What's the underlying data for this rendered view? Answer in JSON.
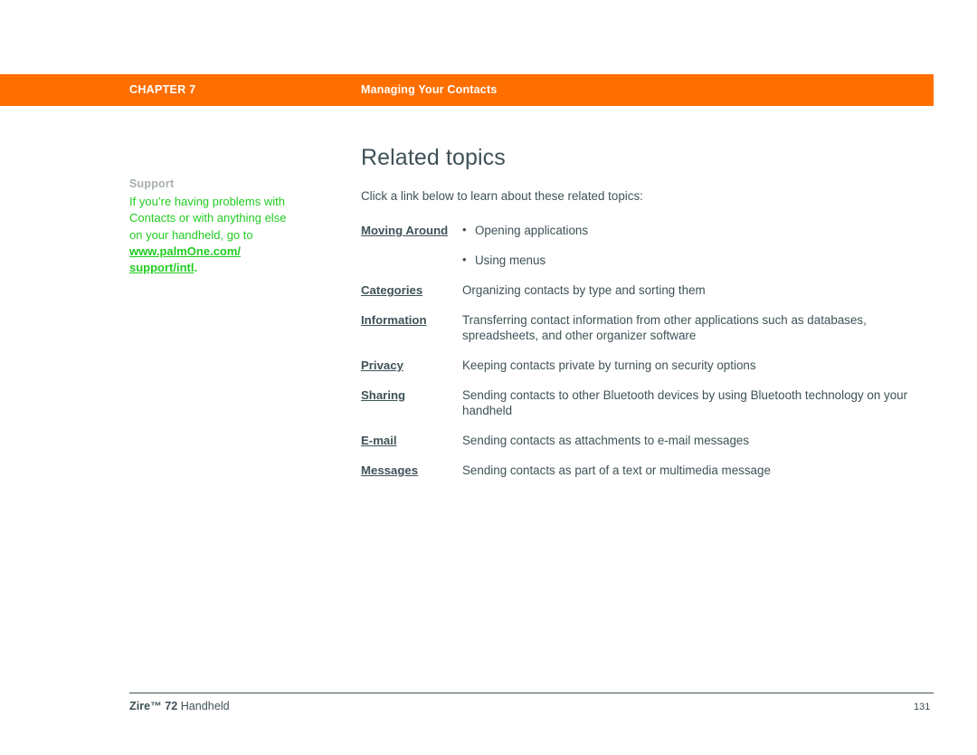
{
  "header": {
    "chapter_label": "CHAPTER 7",
    "section_title": "Managing Your Contacts",
    "bar_color": "#FF6F00"
  },
  "sidebar": {
    "title": "Support",
    "title_color": "#a8b0b2",
    "text_color": "#22CC22",
    "body_text": "If you’re having problems with Contacts or with anything else on your handheld, go to ",
    "link_text": "www.palmOne.com/ support/intl",
    "trailing_punctuation": "."
  },
  "main": {
    "page_title": "Related topics",
    "intro": "Click a link below to learn about these related topics:",
    "text_color": "#3f5257",
    "topics": [
      {
        "link": "Moving Around",
        "description": "",
        "bullets": [
          "Opening applications",
          "Using menus"
        ]
      },
      {
        "link": "Categories",
        "description": "Organizing contacts by type and sorting them",
        "bullets": []
      },
      {
        "link": "Information",
        "description": "Transferring contact information from other applications such as databases, spreadsheets, and other organizer software",
        "bullets": []
      },
      {
        "link": "Privacy",
        "description": "Keeping contacts private by turning on security options",
        "bullets": []
      },
      {
        "link": "Sharing",
        "description": "Sending contacts to other Bluetooth devices by using Bluetooth technology on your handheld",
        "bullets": []
      },
      {
        "link": "E-mail",
        "description": "Sending contacts as attachments to e-mail messages",
        "bullets": []
      },
      {
        "link": "Messages",
        "description": "Sending contacts as part of a text or multimedia message",
        "bullets": []
      }
    ]
  },
  "footer": {
    "product_name": "Zire™ 72",
    "product_suffix": " Handheld",
    "page_number": "131"
  }
}
